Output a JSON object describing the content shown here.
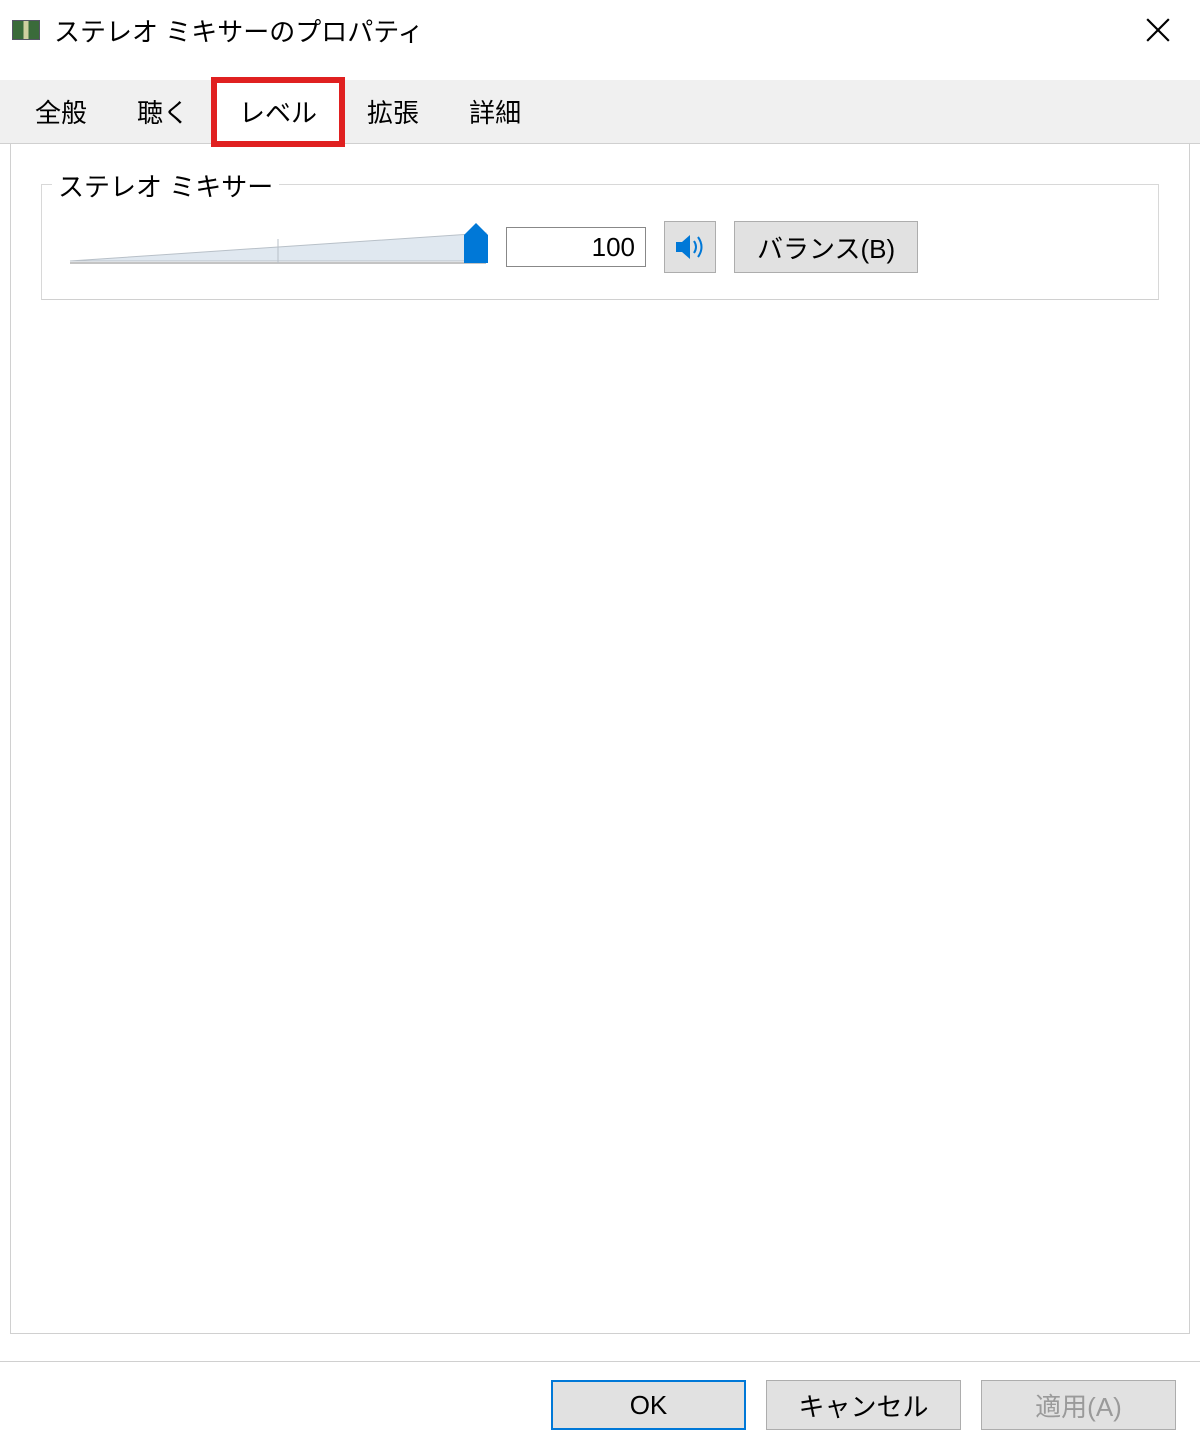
{
  "window": {
    "title": "ステレオ ミキサーのプロパティ"
  },
  "tabs": [
    {
      "label": "全般"
    },
    {
      "label": "聴く"
    },
    {
      "label": "レベル"
    },
    {
      "label": "拡張"
    },
    {
      "label": "詳細"
    }
  ],
  "group": {
    "label": "ステレオ ミキサー",
    "value": "100",
    "slider_percent": 100,
    "balance_label": "バランス(B)"
  },
  "footer": {
    "ok": "OK",
    "cancel": "キャンセル",
    "apply": "適用(A)"
  }
}
